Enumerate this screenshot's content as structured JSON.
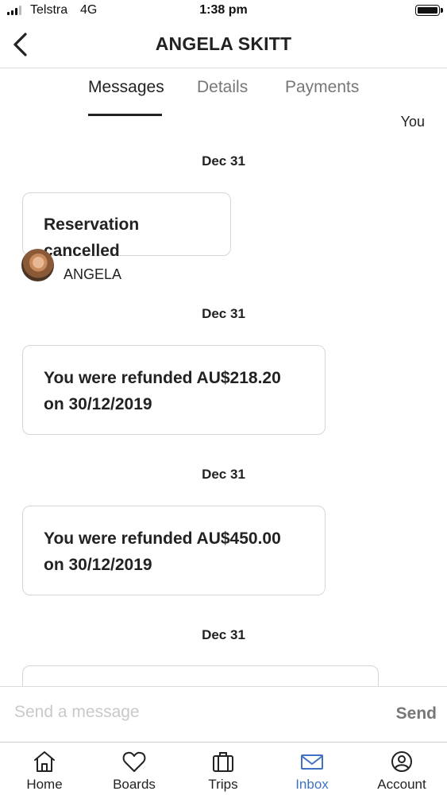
{
  "status_bar": {
    "carrier": "Telstra",
    "network": "4G",
    "time": "1:38 pm"
  },
  "header": {
    "title": "ANGELA SKITT",
    "back_icon": "chevron-left-icon"
  },
  "tabs": [
    {
      "label": "Messages",
      "active": true
    },
    {
      "label": "Details",
      "active": false
    },
    {
      "label": "Payments",
      "active": false
    }
  ],
  "conversation": {
    "you_label": "You",
    "items": [
      {
        "date": "Dec 31",
        "text": "Reservation cancelled",
        "sender": "ANGELA"
      },
      {
        "date": "Dec 31",
        "text": "You were refunded AU$218.20 on 30/12/2019"
      },
      {
        "date": "Dec 31",
        "text": "You were refunded AU$450.00 on 30/12/2019"
      },
      {
        "date": "Dec 31",
        "text": ""
      }
    ]
  },
  "composer": {
    "placeholder": "Send a message",
    "send_label": "Send"
  },
  "bottom_nav": [
    {
      "label": "Home",
      "icon": "home-icon",
      "active": false
    },
    {
      "label": "Boards",
      "icon": "heart-icon",
      "active": false
    },
    {
      "label": "Trips",
      "icon": "suitcase-icon",
      "active": false
    },
    {
      "label": "Inbox",
      "icon": "mail-icon",
      "active": true
    },
    {
      "label": "Account",
      "icon": "account-icon",
      "active": false
    }
  ],
  "colors": {
    "accent": "#3f73c2",
    "text": "#222222",
    "muted": "#777777",
    "placeholder": "#c9c9c9",
    "border": "#d6d6d6"
  }
}
